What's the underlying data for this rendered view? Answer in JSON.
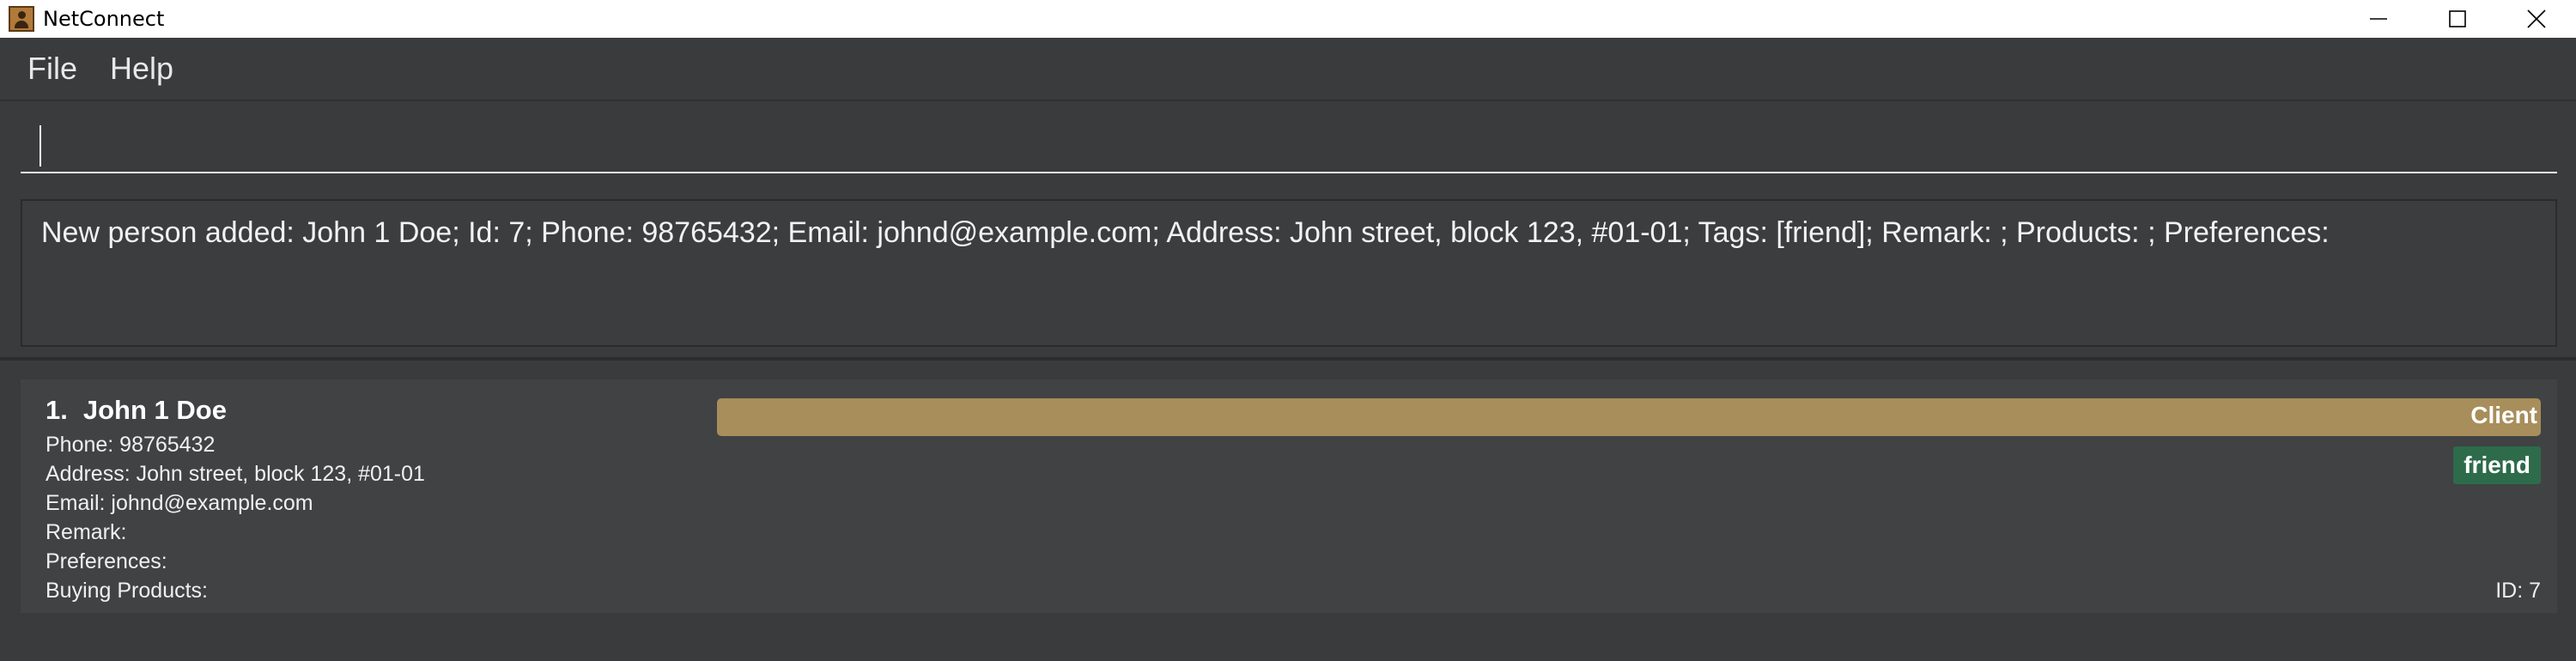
{
  "window": {
    "title": "NetConnect",
    "icon": "contact-card-icon",
    "controls": [
      "minimize-icon",
      "maximize-icon",
      "close-icon"
    ]
  },
  "menu": {
    "file": "File",
    "help": "Help"
  },
  "command": {
    "value": "",
    "placeholder": ""
  },
  "result": {
    "text": "New person added: John 1 Doe; Id: 7; Phone: 98765432; Email: johnd@example.com; Address: John street, block 123, #01-01; Tags: [friend]; Remark: ; Products: ; Preferences:"
  },
  "persons": [
    {
      "index": "1.",
      "name": "John 1 Doe",
      "phone": "Phone: 98765432",
      "address": "Address: John street, block 123, #01-01",
      "email": "Email: johnd@example.com",
      "remark": "Remark:",
      "preferences": "Preferences:",
      "buying_products": "Buying Products:",
      "role": "Client",
      "tags": [
        "friend"
      ],
      "id": "ID: 7"
    }
  ],
  "colors": {
    "client_bar": "#a78e5b",
    "tag_friend": "#2d6b4a",
    "background": "#3a3b3d"
  }
}
